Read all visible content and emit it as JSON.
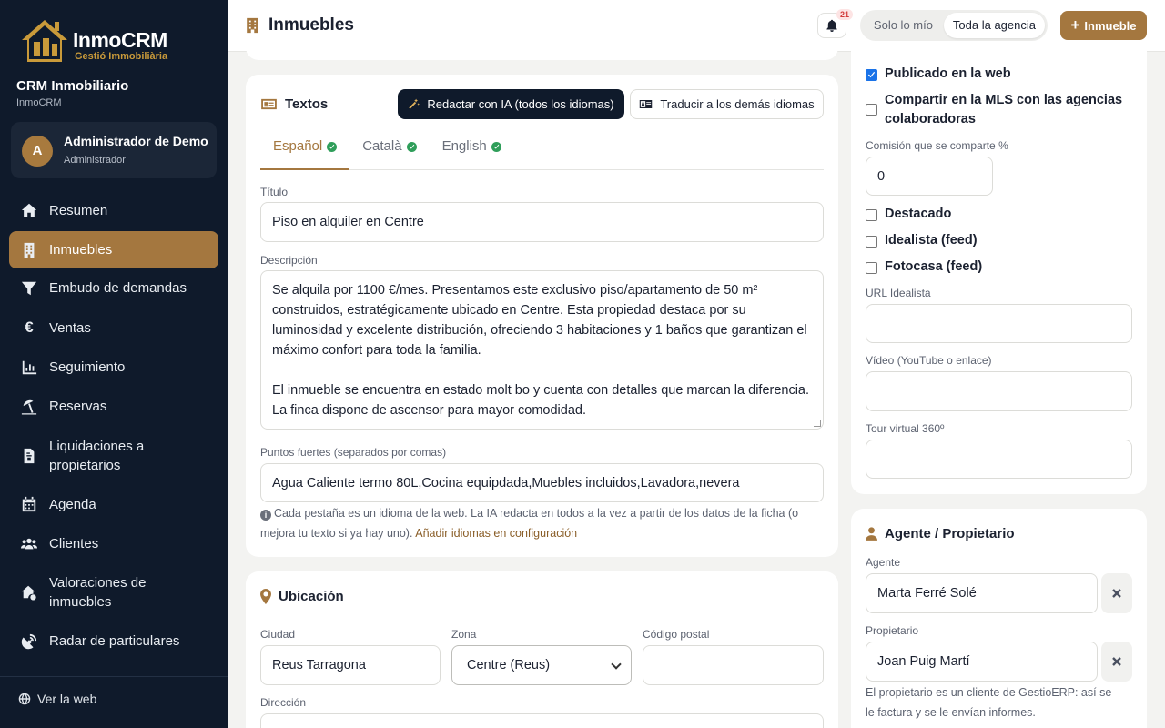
{
  "sidebar": {
    "logo": {
      "title": "InmoCRM",
      "subtitle": "Gestió Immobiliària"
    },
    "crm_title": "CRM Inmobiliario",
    "crm_subtitle": "InmoCRM",
    "user": {
      "initial": "A",
      "name": "Administrador de Demo",
      "role": "Administrador"
    },
    "items": [
      {
        "label": "Resumen",
        "icon": "home-icon"
      },
      {
        "label": "Inmuebles",
        "icon": "building-icon",
        "active": true
      },
      {
        "label": "Embudo de demandas",
        "icon": "funnel-icon"
      },
      {
        "label": "Ventas",
        "icon": "euro-icon"
      },
      {
        "label": "Seguimiento",
        "icon": "chart-icon"
      },
      {
        "label": "Reservas",
        "icon": "umbrella-beach-icon"
      },
      {
        "label": "Liquidaciones a propietarios",
        "icon": "invoice-icon"
      },
      {
        "label": "Agenda",
        "icon": "calendar-icon"
      },
      {
        "label": "Clientes",
        "icon": "users-icon"
      },
      {
        "label": "Valoraciones de inmuebles",
        "icon": "house-value-icon"
      },
      {
        "label": "Radar de particulares",
        "icon": "radar-icon"
      }
    ],
    "view_web": "Ver la web"
  },
  "topbar": {
    "title": "Inmuebles",
    "notifications_count": "21",
    "scope_options": [
      "Solo lo mío",
      "Toda la agencia"
    ],
    "scope_selected": "Toda la agencia",
    "add_button": "Inmueble"
  },
  "textos": {
    "title": "Textos",
    "ai_button": "Redactar con IA (todos los idiomas)",
    "translate_button": "Traducir a los demás idiomas",
    "tabs": [
      {
        "label": "Español",
        "active": true
      },
      {
        "label": "Català"
      },
      {
        "label": "English"
      }
    ],
    "titulo_label": "Título",
    "titulo_value": "Piso en alquiler en Centre",
    "descripcion_label": "Descripción",
    "descripcion_p1": "Se alquila por 1100 €/mes. Presentamos este exclusivo piso/apartamento de 50 m² construidos, estratégicamente ubicado en Centre. Esta propiedad destaca por su luminosidad y excelente distribución, ofreciendo 3 habitaciones y 1 baños que garantizan el máximo confort para toda la familia.",
    "descripcion_p2": "El inmueble se encuentra en estado molt bo y cuenta con detalles que marcan la diferencia. La finca dispone de ascensor para mayor comodidad.",
    "puntos_label": "Puntos fuertes (separados por comas)",
    "puntos_value": "Agua Caliente termo 80L,Cocina equipdada,Muebles incluidos,Lavadora,nevera",
    "hint_text": "Cada pestaña es un idioma de la web. La IA redacta en todos a la vez a partir de los datos de la ficha (o mejora tu texto si ya hay uno).",
    "hint_link": "Añadir idiomas en configuración"
  },
  "ubicacion": {
    "title": "Ubicación",
    "ciudad_label": "Ciudad",
    "ciudad_value": "Reus Tarragona",
    "zona_label": "Zona",
    "zona_value": "Centre (Reus)",
    "cp_label": "Código postal",
    "cp_value": "",
    "direccion_label": "Dirección"
  },
  "publicacion": {
    "publicado_label": "Publicado en la web",
    "publicado_checked": true,
    "mls_label": "Compartir en la MLS con las agencias colaboradoras",
    "mls_checked": false,
    "comision_label": "Comisión que se comparte %",
    "comision_value": "0",
    "destacado_label": "Destacado",
    "idealista_label": "Idealista (feed)",
    "fotocasa_label": "Fotocasa (feed)",
    "url_idealista_label": "URL Idealista",
    "video_label": "Vídeo (YouTube o enlace)",
    "tour_label": "Tour virtual 360º"
  },
  "agente": {
    "title": "Agente / Propietario",
    "agente_label": "Agente",
    "agente_value": "Marta Ferré Solé",
    "propietario_label": "Propietario",
    "propietario_value": "Joan Puig Martí",
    "note": "El propietario es un cliente de GestioERP: así se le factura y se le envían informes."
  },
  "colors": {
    "accent": "#a4773f",
    "sidebar_bg": "#0f1a2b",
    "success": "#2f9e5a"
  }
}
